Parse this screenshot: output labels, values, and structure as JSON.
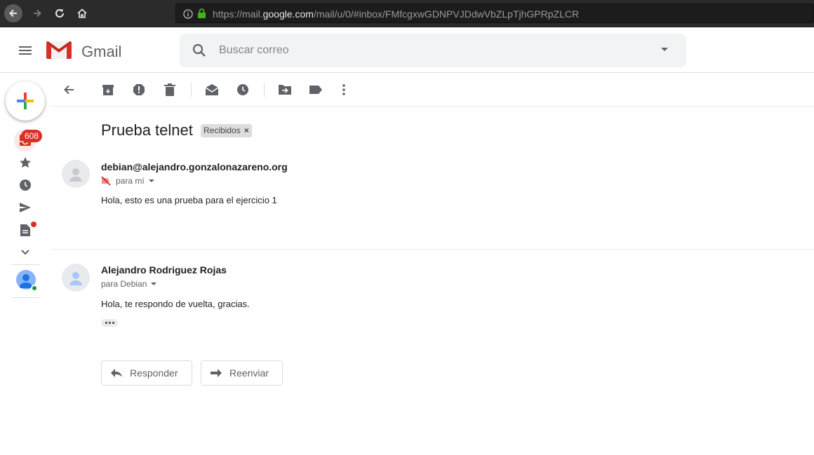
{
  "browser": {
    "url_prefix": "https://mail.",
    "url_host": "google.com",
    "url_path": "/mail/u/0/#inbox/FMfcgxwGDNPVJDdwVbZLpTjhGPRpZLCR"
  },
  "header": {
    "app_name": "Gmail",
    "search_placeholder": "Buscar correo"
  },
  "sidebar": {
    "inbox_count": "608"
  },
  "thread": {
    "subject": "Prueba telnet",
    "label": "Recibidos",
    "label_remove": "×",
    "messages": [
      {
        "sender": "debian@alejandro.gonzalonazareno.org",
        "to": "para mí",
        "body": "Hola, esto es una prueba para el ejercicio 1"
      },
      {
        "sender": "Alejandro Rodriguez Rojas",
        "to": "para Debian",
        "body": "Hola, te respondo de vuelta, gracias."
      }
    ]
  },
  "actions": {
    "reply": "Responder",
    "forward": "Reenviar"
  },
  "colors": {
    "brand_red": "#d93025",
    "icon_gray": "#5f6368"
  }
}
